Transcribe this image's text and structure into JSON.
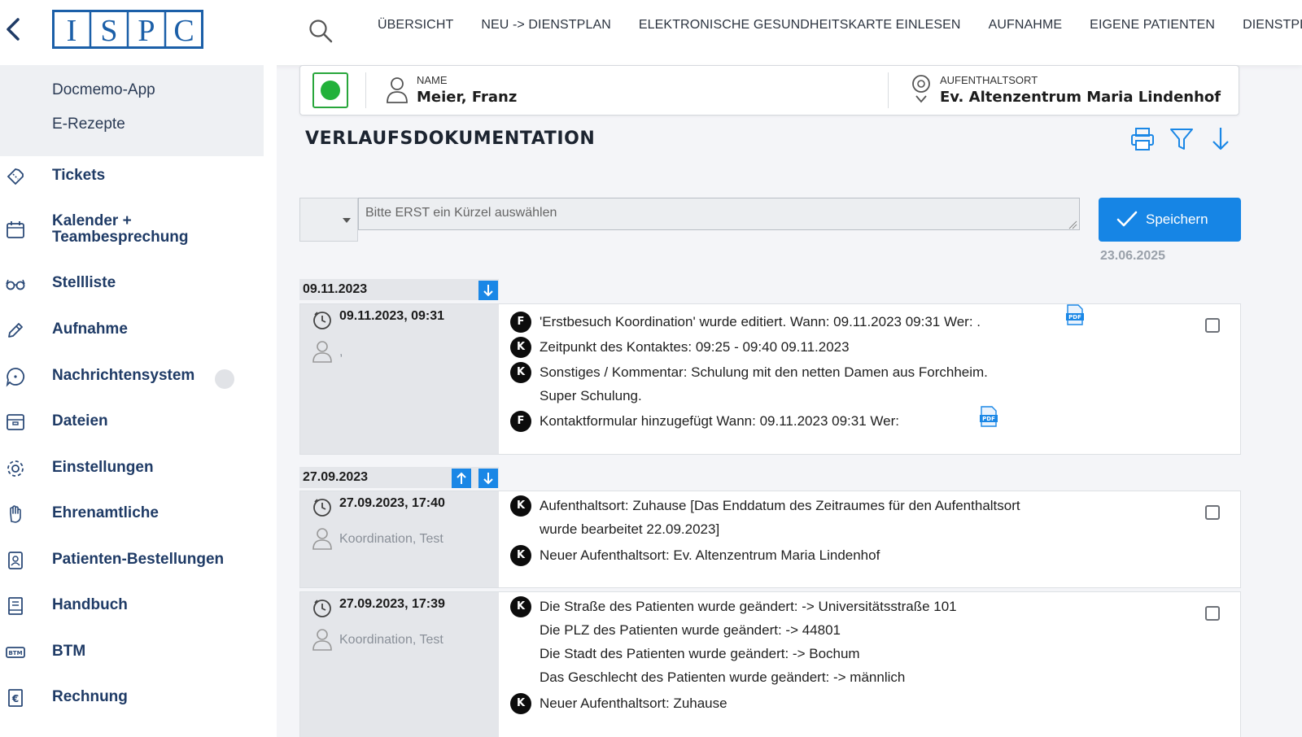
{
  "header": {
    "logo_text": "ISPC",
    "nav": [
      "ÜBERSICHT",
      "NEU -> DIENSTPLAN",
      "ELEKTRONISCHE GESUNDHEITSKARTE EINLESEN",
      "AUFNAHME",
      "EIGENE PATIENTEN",
      "DIENSTPLAN"
    ]
  },
  "sidebar": {
    "sub_items": [
      "Docmemo-App",
      "E-Rezepte"
    ],
    "items": [
      {
        "label": "Tickets",
        "icon": "ticket-icon"
      },
      {
        "label": "Kalender +",
        "label2": "Teambesprechung",
        "icon": "calendar-icon"
      },
      {
        "label": "Stellliste",
        "icon": "glasses-icon"
      },
      {
        "label": "Aufnahme",
        "icon": "pencil-icon"
      },
      {
        "label": "Nachrichtensystem",
        "icon": "chat-icon"
      },
      {
        "label": "Dateien",
        "icon": "archive-icon"
      },
      {
        "label": "Einstellungen",
        "icon": "gear-icon"
      },
      {
        "label": "Ehrenamtliche",
        "icon": "hand-icon"
      },
      {
        "label": "Patienten-Bestellungen",
        "icon": "badge-icon"
      },
      {
        "label": "Handbuch",
        "icon": "book-icon"
      },
      {
        "label": "BTM",
        "icon": "btm-icon"
      },
      {
        "label": "Rechnung",
        "icon": "invoice-icon"
      }
    ]
  },
  "patient": {
    "status_color": "#22b13a",
    "name_caption": "NAME",
    "name": "Meier, Franz",
    "location_caption": "AUFENTHALTSORT",
    "location": "Ev. Altenzentrum Maria Lindenhof"
  },
  "page": {
    "title": "VERLAUFSDOKUMENTATION",
    "input_placeholder": "Bitte ERST ein Kürzel auswählen",
    "save_label": "Speichern",
    "save_date": "23.06.2025"
  },
  "groups": [
    {
      "date": "09.11.2023",
      "entries": [
        {
          "timestamp": "09.11.2023, 09:31",
          "user": ",",
          "lines": [
            {
              "badge": "F",
              "text": "'Erstbesuch Koordination' wurde editiert. Wann: 09.11.2023 09:31 Wer: ."
            },
            {
              "badge": "K",
              "text": "Zeitpunkt des Kontaktes: 09:25 - 09:40 09.11.2023"
            },
            {
              "badge": "K",
              "text": "Sonstiges / Kommentar: Schulung mit den netten Damen aus Forchheim.",
              "cont": [
                "Super Schulung."
              ]
            },
            {
              "badge": "F",
              "text": "Kontaktformular hinzugefügt Wann: 09.11.2023 09:31 Wer:"
            }
          ]
        }
      ]
    },
    {
      "date": "27.09.2023",
      "entries": [
        {
          "timestamp": "27.09.2023, 17:40",
          "user": "Koordination, Test",
          "lines": [
            {
              "badge": "K",
              "text": "Aufenthaltsort: Zuhause [Das Enddatum des Zeitraumes für den Aufenthaltsort",
              "cont": [
                "wurde bearbeitet 22.09.2023]"
              ]
            },
            {
              "badge": "K",
              "text": "Neuer Aufenthaltsort: Ev. Altenzentrum Maria Lindenhof"
            }
          ]
        },
        {
          "timestamp": "27.09.2023, 17:39",
          "user": "Koordination, Test",
          "lines": [
            {
              "badge": "K",
              "text": "Die Straße des Patienten wurde geändert: -> Universitätsstraße 101",
              "cont": [
                "Die PLZ des Patienten wurde geändert: -> 44801",
                "Die Stadt des Patienten wurde geändert: -> Bochum",
                "Das Geschlecht des Patienten wurde geändert: -> männlich"
              ]
            },
            {
              "badge": "K",
              "text": "Neuer Aufenthaltsort: Zuhause"
            }
          ]
        }
      ]
    }
  ],
  "colors": {
    "accent": "#1685e5",
    "sidebar_text": "#1f3b66"
  }
}
